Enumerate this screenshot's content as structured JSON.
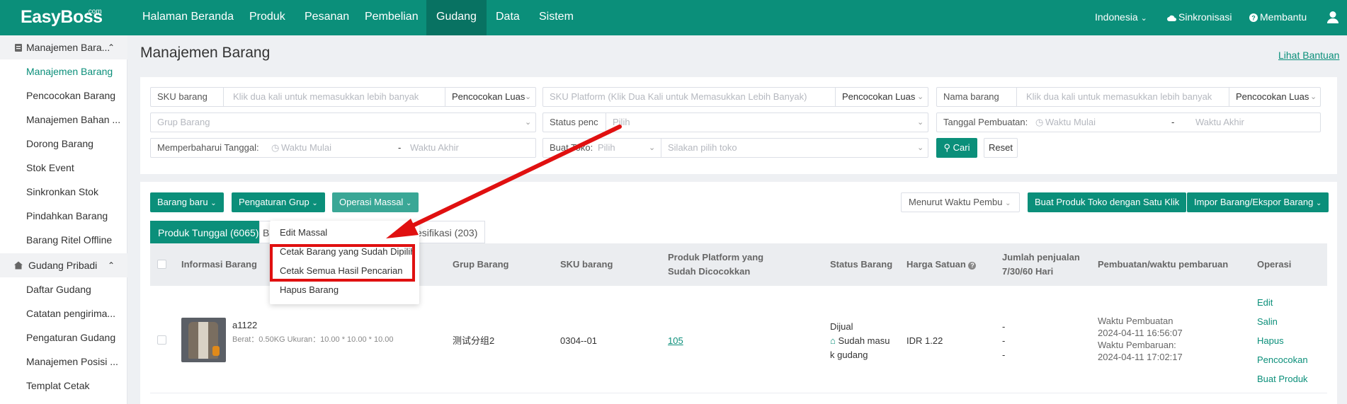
{
  "brand": {
    "logo": "EasyBoss",
    "logo_suffix": ".com",
    "accent": "#0b8f7a"
  },
  "topnav": {
    "items": [
      "Halaman Beranda",
      "Produk",
      "Pesanan",
      "Pembelian",
      "Gudang",
      "Data",
      "Sistem"
    ],
    "active": "Gudang",
    "language": "Indonesia",
    "sync": "Sinkronisasi",
    "help": "Membantu"
  },
  "sidebar": {
    "group1": "Manajemen Bara...",
    "group1_items": [
      "Manajemen Barang",
      "Pencocokan Barang",
      "Manajemen Bahan ...",
      "Dorong Barang",
      "Stok Event",
      "Sinkronkan Stok",
      "Pindahkan Barang",
      "Barang Ritel Offline"
    ],
    "group2": "Gudang Pribadi",
    "group2_items": [
      "Daftar Gudang",
      "Catatan pengirima...",
      "Pengaturan Gudang",
      "Manajemen Posisi ...",
      "Templat Cetak"
    ]
  },
  "page": {
    "title": "Manajemen Barang",
    "help_link": "Lihat Bantuan"
  },
  "filters": {
    "sku_label": "SKU barang",
    "sku_placeholder": "Klik dua kali untuk memasukkan lebih banyak",
    "match_mode": "Pencocokan Luas",
    "platform_sku_placeholder": "SKU Platform (Klik Dua Kali untuk Memasukkan Lebih Banyak)",
    "name_label": "Nama barang",
    "name_placeholder": "Klik dua kali untuk memasukkan lebih banyak",
    "group_placeholder": "Grup Barang",
    "status_label": "Status penc",
    "status_placeholder": "Pilih",
    "created_label": "Tanggal Pembuatan:",
    "start_time": "Waktu Mulai",
    "end_time": "Waktu Akhir",
    "dash": "-",
    "updated_label": "Memperbaharui Tanggal:",
    "store_label": "Buat Toko:",
    "store_placeholder": "Pilih",
    "shop_placeholder": "Silakan pilih toko",
    "search_button": "Cari",
    "reset_button": "Reset"
  },
  "toolbar": {
    "new_item": "Barang baru",
    "group_settings": "Pengaturan Grup",
    "bulk_ops": "Operasi Massal",
    "sort": "Menurut Waktu Pembu",
    "one_click": "Buat Produk Toko dengan Satu Klik",
    "import_export": "Impor Barang/Ekspor Barang"
  },
  "tabs": {
    "single": "Produk Tunggal (6065)",
    "hidden_prefix": "B",
    "variant": "esifikasi (203)"
  },
  "dropdown": [
    "Edit Massal",
    "Cetak Barang yang Sudah Dipilih",
    "Cetak Semua Hasil Pencarian",
    "Hapus Barang"
  ],
  "table": {
    "headers": {
      "info": "Informasi Barang",
      "group": "Grup Barang",
      "sku": "SKU barang",
      "platform": "Produk Platform yang Sudah Dicocokkan",
      "status": "Status Barang",
      "price": "Harga Satuan",
      "sales": "Jumlah penjualan 7/30/60 Hari",
      "created": "Pembuatan/waktu pembaruan",
      "ops": "Operasi"
    },
    "row": {
      "name": "a1122",
      "meta": "Berat：0.50KG   Ukuran：10.00 * 10.00 * 10.00",
      "group": "测试分组2",
      "sku": "0304--01",
      "platform_count": "105",
      "status": "Dijual",
      "status2": "Sudah masu",
      "status3": "k gudang",
      "price": "IDR 1.22",
      "sales": [
        "-",
        "-",
        "-"
      ],
      "created_label": "Waktu Pembuatan",
      "created": "2024-04-11 16:56:07",
      "updated_label": "Waktu Pembaruan:",
      "updated": "2024-04-11 17:02:17",
      "ops": [
        "Edit",
        "Salin",
        "Hapus",
        "Pencocokan",
        "Buat Produk"
      ]
    }
  },
  "annotation_color": "#e01010"
}
